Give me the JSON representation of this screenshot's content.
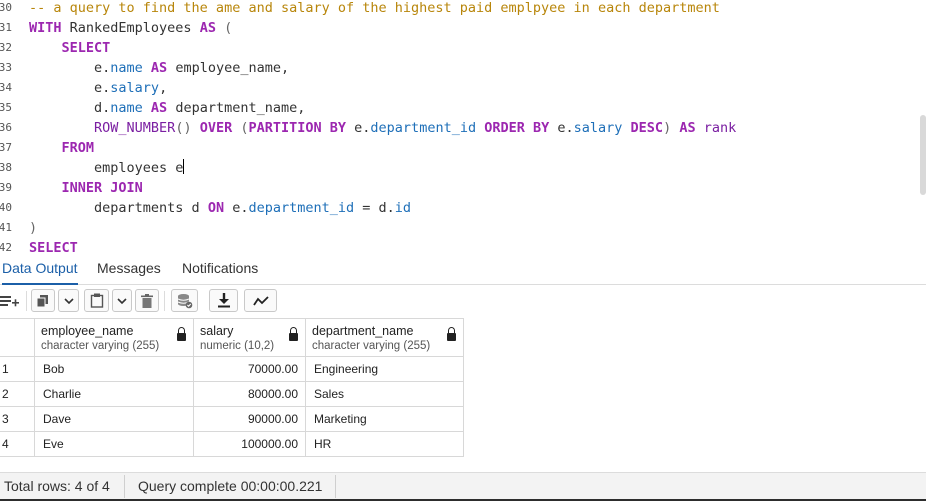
{
  "editor": {
    "lines": [
      {
        "n": "30",
        "parts": [
          {
            "t": "-- a query to find the ame and salary of the highest paid emplpyee in each department",
            "c": "cm"
          }
        ]
      },
      {
        "n": "31",
        "parts": [
          {
            "t": "WITH",
            "c": "kw"
          },
          {
            "t": " RankedEmployees ",
            "c": "id"
          },
          {
            "t": "AS",
            "c": "kw"
          },
          {
            "t": " (",
            "c": "pn"
          }
        ]
      },
      {
        "n": "32",
        "parts": [
          {
            "t": "    SELECT",
            "c": "kw"
          }
        ]
      },
      {
        "n": "33",
        "parts": [
          {
            "t": "        e.",
            "c": "id"
          },
          {
            "t": "name",
            "c": "prop"
          },
          {
            "t": " AS ",
            "c": "kw"
          },
          {
            "t": "employee_name,",
            "c": "id"
          }
        ]
      },
      {
        "n": "34",
        "parts": [
          {
            "t": "        e.",
            "c": "id"
          },
          {
            "t": "salary",
            "c": "prop"
          },
          {
            "t": ",",
            "c": "id"
          }
        ]
      },
      {
        "n": "35",
        "parts": [
          {
            "t": "        d.",
            "c": "id"
          },
          {
            "t": "name",
            "c": "prop"
          },
          {
            "t": " AS ",
            "c": "kw"
          },
          {
            "t": "department_name,",
            "c": "id"
          }
        ]
      },
      {
        "n": "36",
        "parts": [
          {
            "t": "        ROW_NUMBER",
            "c": "fn"
          },
          {
            "t": "() ",
            "c": "pn"
          },
          {
            "t": "OVER",
            "c": "kw"
          },
          {
            "t": " (",
            "c": "pn"
          },
          {
            "t": "PARTITION BY",
            "c": "kw"
          },
          {
            "t": " e.",
            "c": "id"
          },
          {
            "t": "department_id",
            "c": "prop"
          },
          {
            "t": " ORDER BY",
            "c": "kw"
          },
          {
            "t": " e.",
            "c": "id"
          },
          {
            "t": "salary",
            "c": "prop"
          },
          {
            "t": " DESC",
            "c": "kw"
          },
          {
            "t": ") ",
            "c": "pn"
          },
          {
            "t": "AS",
            "c": "kw"
          },
          {
            "t": " rank",
            "c": "kw2"
          }
        ]
      },
      {
        "n": "37",
        "parts": [
          {
            "t": "    FROM",
            "c": "kw"
          }
        ]
      },
      {
        "n": "38",
        "parts": [
          {
            "t": "        employees e",
            "c": "id"
          }
        ],
        "caret": true
      },
      {
        "n": "39",
        "parts": [
          {
            "t": "    INNER JOIN",
            "c": "kw"
          }
        ]
      },
      {
        "n": "40",
        "parts": [
          {
            "t": "        departments d ",
            "c": "id"
          },
          {
            "t": "ON",
            "c": "kw"
          },
          {
            "t": " e.",
            "c": "id"
          },
          {
            "t": "department_id",
            "c": "prop"
          },
          {
            "t": " = d.",
            "c": "id"
          },
          {
            "t": "id",
            "c": "prop"
          }
        ]
      },
      {
        "n": "41",
        "parts": [
          {
            "t": ")",
            "c": "pn"
          }
        ]
      },
      {
        "n": "42",
        "parts": [
          {
            "t": "SELECT",
            "c": "kw"
          }
        ]
      }
    ]
  },
  "tabs": [
    {
      "label": "Data Output",
      "active": true
    },
    {
      "label": "Messages",
      "active": false
    },
    {
      "label": "Notifications",
      "active": false
    }
  ],
  "toolbar": {
    "icons": [
      "add-row-icon",
      "copy-icon",
      "chevron-down-icon",
      "paste-icon",
      "chevron-down-icon",
      "delete-icon",
      "save-data-icon",
      "download-icon",
      "graph-icon"
    ]
  },
  "grid": {
    "columns": [
      {
        "name": "employee_name",
        "type": "character varying (255)"
      },
      {
        "name": "salary",
        "type": "numeric (10,2)"
      },
      {
        "name": "department_name",
        "type": "character varying (255)"
      }
    ],
    "rows": [
      {
        "num": "1",
        "cells": [
          "Bob",
          "70000.00",
          "Engineering"
        ]
      },
      {
        "num": "2",
        "cells": [
          "Charlie",
          "80000.00",
          "Sales"
        ]
      },
      {
        "num": "3",
        "cells": [
          "Dave",
          "90000.00",
          "Marketing"
        ]
      },
      {
        "num": "4",
        "cells": [
          "Eve",
          "100000.00",
          "HR"
        ]
      }
    ]
  },
  "status": {
    "total_rows": "Total rows: 4 of 4",
    "query_complete": "Query complete 00:00:00.221"
  }
}
